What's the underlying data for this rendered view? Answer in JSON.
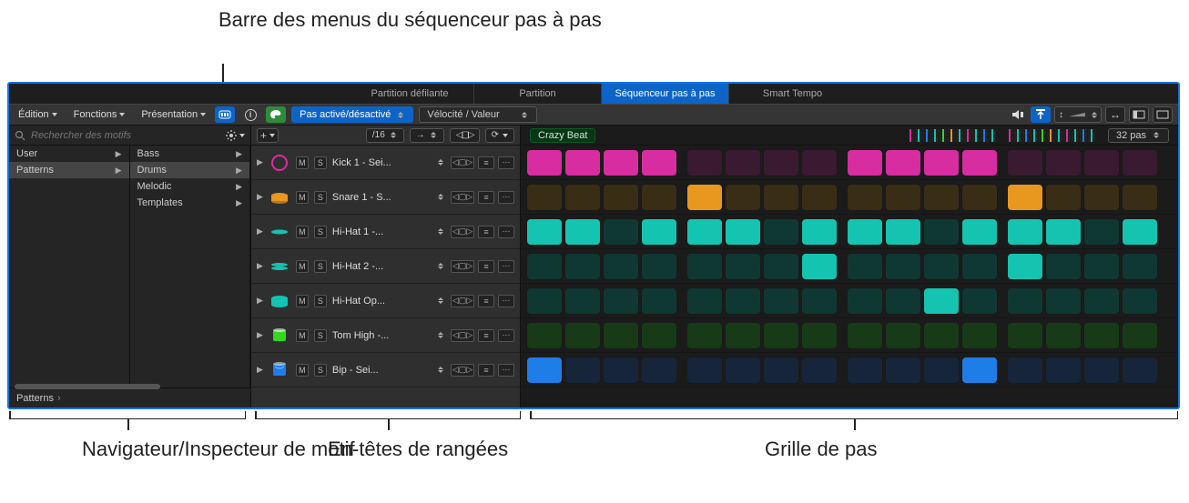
{
  "annotations": {
    "top": "Barre des menus du séquenceur pas à pas",
    "bottom_left": "Navigateur/Inspecteur de motif",
    "bottom_mid": "En-têtes de rangées",
    "bottom_right": "Grille de pas"
  },
  "tabs": {
    "items": [
      {
        "label": "Partition défilante",
        "selected": false
      },
      {
        "label": "Partition",
        "selected": false
      },
      {
        "label": "Séquenceur pas à pas",
        "selected": true
      },
      {
        "label": "Smart Tempo",
        "selected": false
      }
    ]
  },
  "menubar": {
    "menus": [
      "Édition",
      "Fonctions",
      "Présentation"
    ],
    "step_mode_label": "Pas activé/désactivé",
    "value_mode_label": "Vélocité / Valeur"
  },
  "browser": {
    "search_placeholder": "Rechercher des motifs",
    "col1": [
      {
        "label": "User",
        "selected": false
      },
      {
        "label": "Patterns",
        "selected": true
      }
    ],
    "col2": [
      {
        "label": "Bass",
        "selected": false
      },
      {
        "label": "Drums",
        "selected": true
      },
      {
        "label": "Melodic",
        "selected": false
      },
      {
        "label": "Templates",
        "selected": false
      }
    ],
    "footer_label": "Patterns"
  },
  "rowheaders": {
    "division_label": "/16",
    "rows": [
      {
        "name": "Kick 1 - Sei...",
        "color": "#d82da0",
        "icon": "kick"
      },
      {
        "name": "Snare 1 - S...",
        "color": "#e8981f",
        "icon": "snare"
      },
      {
        "name": "Hi-Hat 1 -...",
        "color": "#14c4b0",
        "icon": "hihat"
      },
      {
        "name": "Hi-Hat 2 -...",
        "color": "#14c4b0",
        "icon": "hihat2"
      },
      {
        "name": "Hi-Hat Op...",
        "color": "#14c4b0",
        "icon": "hihatopen"
      },
      {
        "name": "Tom High -...",
        "color": "#32d81f",
        "icon": "tom"
      },
      {
        "name": "Bip - Sei...",
        "color": "#1f7de8",
        "icon": "bip"
      }
    ],
    "ms": {
      "m": "M",
      "s": "S"
    }
  },
  "grid": {
    "region_name": "Crazy Beat",
    "steps_label": "32 pas",
    "step_count": 16,
    "rows": [
      {
        "tint": "#3a1a31",
        "on": "#d82da0",
        "steps": [
          1,
          1,
          1,
          1,
          0,
          0,
          0,
          0,
          1,
          1,
          1,
          1,
          0,
          0,
          0,
          0
        ]
      },
      {
        "tint": "#3a2d16",
        "on": "#e8981f",
        "steps": [
          0,
          0,
          0,
          0,
          1,
          0,
          0,
          0,
          0,
          0,
          0,
          0,
          1,
          0,
          0,
          0
        ]
      },
      {
        "tint": "#103833",
        "on": "#14c4b0",
        "steps": [
          1,
          1,
          0,
          1,
          1,
          1,
          0,
          1,
          1,
          1,
          0,
          1,
          1,
          1,
          0,
          1
        ]
      },
      {
        "tint": "#103833",
        "on": "#14c4b0",
        "steps": [
          0,
          0,
          0,
          0,
          0,
          0,
          0,
          1,
          0,
          0,
          0,
          0,
          1,
          0,
          0,
          0
        ]
      },
      {
        "tint": "#103833",
        "on": "#14c4b0",
        "steps": [
          0,
          0,
          0,
          0,
          0,
          0,
          0,
          0,
          0,
          0,
          1,
          0,
          0,
          0,
          0,
          0
        ]
      },
      {
        "tint": "#173a17",
        "on": "#32d81f",
        "steps": [
          0,
          0,
          0,
          0,
          0,
          0,
          0,
          0,
          0,
          0,
          0,
          0,
          0,
          0,
          0,
          0
        ]
      },
      {
        "tint": "#17253a",
        "on": "#1f7de8",
        "steps": [
          1,
          0,
          0,
          0,
          0,
          0,
          0,
          0,
          0,
          0,
          0,
          1,
          0,
          0,
          0,
          0
        ]
      }
    ]
  }
}
